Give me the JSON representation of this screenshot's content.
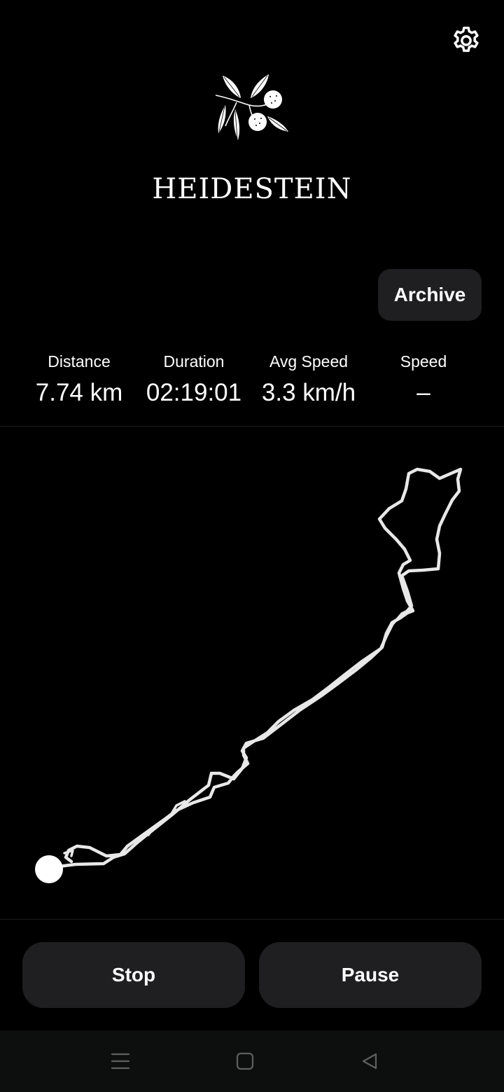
{
  "header": {
    "app_title": "HEIDESTEIN",
    "settings_icon": "gear-icon",
    "logo_icon": "chestnut-branch-logo"
  },
  "actions": {
    "archive_label": "Archive",
    "stop_label": "Stop",
    "pause_label": "Pause"
  },
  "stats": [
    {
      "label": "Distance",
      "value": "7.74 km"
    },
    {
      "label": "Duration",
      "value": "02:19:01"
    },
    {
      "label": "Avg Speed",
      "value": "3.3 km/h"
    },
    {
      "label": "Speed",
      "value": "–"
    }
  ],
  "map": {
    "route_color": "#e8e8e8",
    "position_marker_color": "#ffffff",
    "position_marker_icon": "current-position-dot"
  },
  "system_nav": {
    "menu_icon": "menu-icon",
    "home_icon": "home-icon",
    "back_icon": "back-icon",
    "icon_color": "#5c6160"
  },
  "colors": {
    "background": "#000000",
    "button_background": "#1f1f21",
    "text": "#ffffff"
  }
}
